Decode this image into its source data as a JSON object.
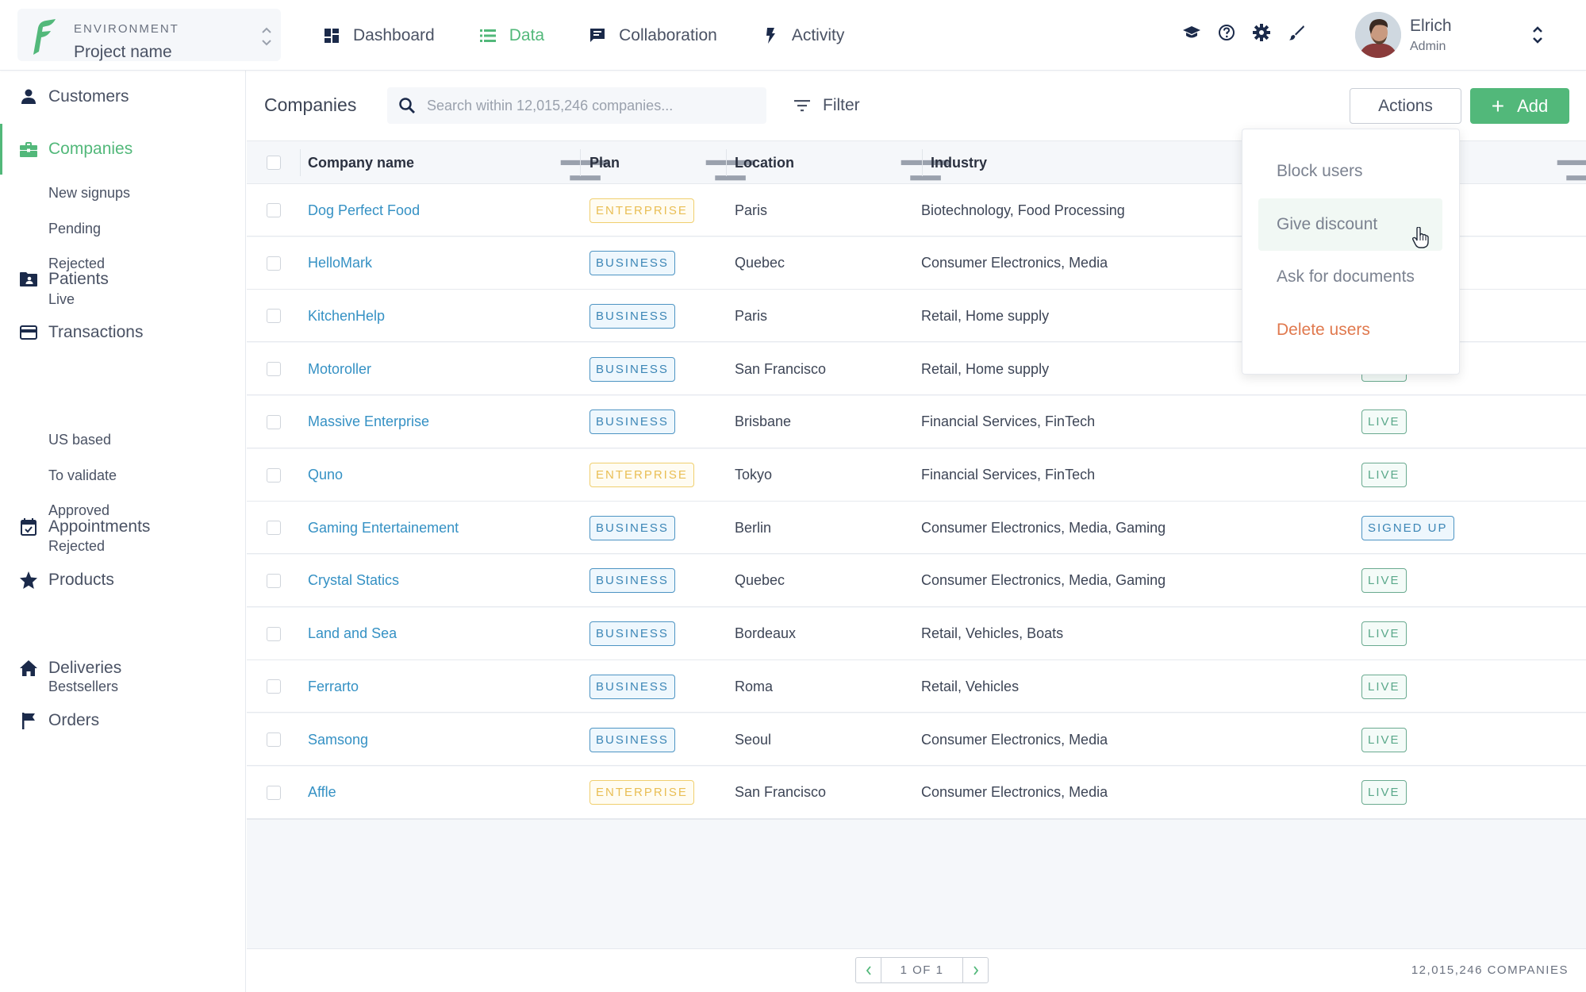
{
  "header": {
    "environment_label": "ENVIRONMENT",
    "project_name": "Project name",
    "nav": [
      {
        "label": "Dashboard",
        "icon": "dashboard-icon",
        "active": false
      },
      {
        "label": "Data",
        "icon": "list-icon",
        "active": true
      },
      {
        "label": "Collaboration",
        "icon": "chat-icon",
        "active": false
      },
      {
        "label": "Activity",
        "icon": "lightning-icon",
        "active": false
      }
    ],
    "tools": [
      "graduation-cap-icon",
      "help-icon",
      "gear-icon",
      "brush-icon"
    ],
    "user": {
      "name": "Elrich",
      "role": "Admin"
    }
  },
  "sidebar": {
    "items": [
      {
        "label": "Customers",
        "icon": "person-icon"
      },
      {
        "label": "Companies",
        "icon": "briefcase-icon",
        "active": true,
        "children": [
          "New signups",
          "Pending",
          "Rejected",
          "Live"
        ]
      },
      {
        "label": "Patients",
        "icon": "folder-user-icon"
      },
      {
        "label": "Transactions",
        "icon": "credit-card-icon",
        "children": [
          "US based",
          "To validate",
          "Approved",
          "Rejected"
        ]
      },
      {
        "label": "Appointments",
        "icon": "calendar-check-icon"
      },
      {
        "label": "Products",
        "icon": "star-icon",
        "children": [
          "Bestsellers"
        ]
      },
      {
        "label": "Deliveries",
        "icon": "home-icon"
      },
      {
        "label": "Orders",
        "icon": "flag-icon"
      }
    ]
  },
  "toolbar": {
    "title": "Companies",
    "search_placeholder": "Search within 12,015,246 companies...",
    "search_value": "",
    "filter_label": "Filter",
    "actions_label": "Actions",
    "add_label": "Add"
  },
  "table": {
    "columns": [
      "Company name",
      "Plan",
      "Location",
      "Industry",
      ""
    ],
    "rows": [
      {
        "name": "Dog Perfect Food",
        "plan": "ENTERPRISE",
        "location": "Paris",
        "industry": "Biotechnology, Food Processing",
        "status": ""
      },
      {
        "name": "HelloMark",
        "plan": "BUSINESS",
        "location": "Quebec",
        "industry": "Consumer Electronics, Media",
        "status": ""
      },
      {
        "name": "KitchenHelp",
        "plan": "BUSINESS",
        "location": "Paris",
        "industry": "Retail, Home supply",
        "status": ""
      },
      {
        "name": "Motoroller",
        "plan": "BUSINESS",
        "location": "San Francisco",
        "industry": "Retail, Home supply",
        "status": "LIVE"
      },
      {
        "name": "Massive Enterprise",
        "plan": "BUSINESS",
        "location": "Brisbane",
        "industry": "Financial Services, FinTech",
        "status": "LIVE"
      },
      {
        "name": "Quno",
        "plan": "ENTERPRISE",
        "location": "Tokyo",
        "industry": "Financial Services, FinTech",
        "status": "LIVE"
      },
      {
        "name": "Gaming Entertainement",
        "plan": "BUSINESS",
        "location": "Berlin",
        "industry": "Consumer Electronics, Media, Gaming",
        "status": "SIGNED UP"
      },
      {
        "name": "Crystal Statics",
        "plan": "BUSINESS",
        "location": "Quebec",
        "industry": "Consumer Electronics, Media, Gaming",
        "status": "LIVE"
      },
      {
        "name": "Land and Sea",
        "plan": "BUSINESS",
        "location": "Bordeaux",
        "industry": "Retail, Vehicles, Boats",
        "status": "LIVE"
      },
      {
        "name": "Ferrarto",
        "plan": "BUSINESS",
        "location": "Roma",
        "industry": "Retail, Vehicles",
        "status": "LIVE"
      },
      {
        "name": "Samsong",
        "plan": "BUSINESS",
        "location": "Seoul",
        "industry": "Consumer Electronics, Media",
        "status": "LIVE"
      },
      {
        "name": "Affle",
        "plan": "ENTERPRISE",
        "location": "San Francisco",
        "industry": "Consumer Electronics, Media",
        "status": "LIVE"
      }
    ]
  },
  "footer": {
    "page_info": "1 OF 1",
    "total": "12,015,246 COMPANIES"
  },
  "actions_menu": {
    "items": [
      {
        "label": "Block users",
        "hover": false,
        "danger": false
      },
      {
        "label": "Give discount",
        "hover": true,
        "danger": false
      },
      {
        "label": "Ask for documents",
        "hover": false,
        "danger": false
      },
      {
        "label": "Delete users",
        "hover": false,
        "danger": true
      }
    ]
  },
  "colors": {
    "accent": "#52b87a",
    "link": "#3591c4",
    "icon_dark": "#1b2a4a",
    "danger": "#e0794e",
    "enterprise": "#e9be54",
    "business": "#3c86b6",
    "live": "#5aa88a"
  }
}
